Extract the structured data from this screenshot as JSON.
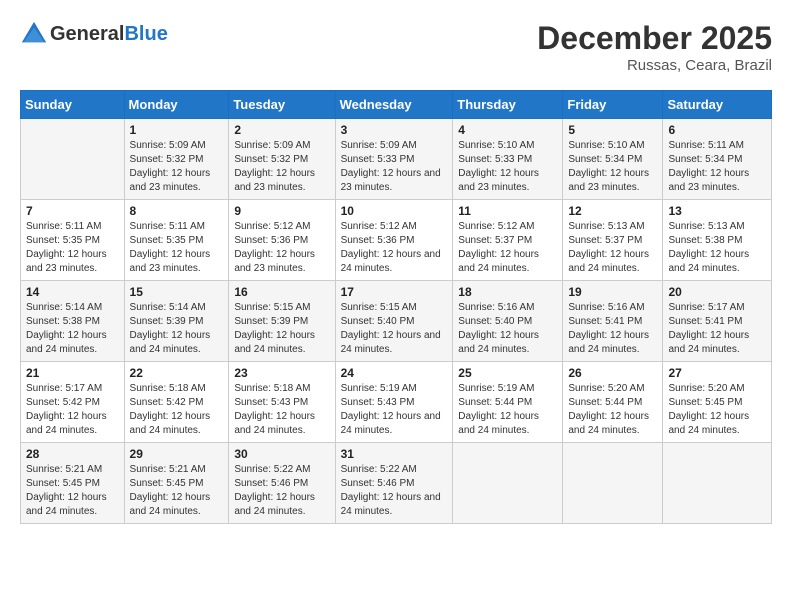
{
  "header": {
    "logo_line1": "General",
    "logo_line2": "Blue",
    "month_title": "December 2025",
    "location": "Russas, Ceara, Brazil"
  },
  "days_of_week": [
    "Sunday",
    "Monday",
    "Tuesday",
    "Wednesday",
    "Thursday",
    "Friday",
    "Saturday"
  ],
  "weeks": [
    [
      {
        "num": "",
        "sunrise": "",
        "sunset": "",
        "daylight": ""
      },
      {
        "num": "1",
        "sunrise": "Sunrise: 5:09 AM",
        "sunset": "Sunset: 5:32 PM",
        "daylight": "Daylight: 12 hours and 23 minutes."
      },
      {
        "num": "2",
        "sunrise": "Sunrise: 5:09 AM",
        "sunset": "Sunset: 5:32 PM",
        "daylight": "Daylight: 12 hours and 23 minutes."
      },
      {
        "num": "3",
        "sunrise": "Sunrise: 5:09 AM",
        "sunset": "Sunset: 5:33 PM",
        "daylight": "Daylight: 12 hours and 23 minutes."
      },
      {
        "num": "4",
        "sunrise": "Sunrise: 5:10 AM",
        "sunset": "Sunset: 5:33 PM",
        "daylight": "Daylight: 12 hours and 23 minutes."
      },
      {
        "num": "5",
        "sunrise": "Sunrise: 5:10 AM",
        "sunset": "Sunset: 5:34 PM",
        "daylight": "Daylight: 12 hours and 23 minutes."
      },
      {
        "num": "6",
        "sunrise": "Sunrise: 5:11 AM",
        "sunset": "Sunset: 5:34 PM",
        "daylight": "Daylight: 12 hours and 23 minutes."
      }
    ],
    [
      {
        "num": "7",
        "sunrise": "Sunrise: 5:11 AM",
        "sunset": "Sunset: 5:35 PM",
        "daylight": "Daylight: 12 hours and 23 minutes."
      },
      {
        "num": "8",
        "sunrise": "Sunrise: 5:11 AM",
        "sunset": "Sunset: 5:35 PM",
        "daylight": "Daylight: 12 hours and 23 minutes."
      },
      {
        "num": "9",
        "sunrise": "Sunrise: 5:12 AM",
        "sunset": "Sunset: 5:36 PM",
        "daylight": "Daylight: 12 hours and 23 minutes."
      },
      {
        "num": "10",
        "sunrise": "Sunrise: 5:12 AM",
        "sunset": "Sunset: 5:36 PM",
        "daylight": "Daylight: 12 hours and 24 minutes."
      },
      {
        "num": "11",
        "sunrise": "Sunrise: 5:12 AM",
        "sunset": "Sunset: 5:37 PM",
        "daylight": "Daylight: 12 hours and 24 minutes."
      },
      {
        "num": "12",
        "sunrise": "Sunrise: 5:13 AM",
        "sunset": "Sunset: 5:37 PM",
        "daylight": "Daylight: 12 hours and 24 minutes."
      },
      {
        "num": "13",
        "sunrise": "Sunrise: 5:13 AM",
        "sunset": "Sunset: 5:38 PM",
        "daylight": "Daylight: 12 hours and 24 minutes."
      }
    ],
    [
      {
        "num": "14",
        "sunrise": "Sunrise: 5:14 AM",
        "sunset": "Sunset: 5:38 PM",
        "daylight": "Daylight: 12 hours and 24 minutes."
      },
      {
        "num": "15",
        "sunrise": "Sunrise: 5:14 AM",
        "sunset": "Sunset: 5:39 PM",
        "daylight": "Daylight: 12 hours and 24 minutes."
      },
      {
        "num": "16",
        "sunrise": "Sunrise: 5:15 AM",
        "sunset": "Sunset: 5:39 PM",
        "daylight": "Daylight: 12 hours and 24 minutes."
      },
      {
        "num": "17",
        "sunrise": "Sunrise: 5:15 AM",
        "sunset": "Sunset: 5:40 PM",
        "daylight": "Daylight: 12 hours and 24 minutes."
      },
      {
        "num": "18",
        "sunrise": "Sunrise: 5:16 AM",
        "sunset": "Sunset: 5:40 PM",
        "daylight": "Daylight: 12 hours and 24 minutes."
      },
      {
        "num": "19",
        "sunrise": "Sunrise: 5:16 AM",
        "sunset": "Sunset: 5:41 PM",
        "daylight": "Daylight: 12 hours and 24 minutes."
      },
      {
        "num": "20",
        "sunrise": "Sunrise: 5:17 AM",
        "sunset": "Sunset: 5:41 PM",
        "daylight": "Daylight: 12 hours and 24 minutes."
      }
    ],
    [
      {
        "num": "21",
        "sunrise": "Sunrise: 5:17 AM",
        "sunset": "Sunset: 5:42 PM",
        "daylight": "Daylight: 12 hours and 24 minutes."
      },
      {
        "num": "22",
        "sunrise": "Sunrise: 5:18 AM",
        "sunset": "Sunset: 5:42 PM",
        "daylight": "Daylight: 12 hours and 24 minutes."
      },
      {
        "num": "23",
        "sunrise": "Sunrise: 5:18 AM",
        "sunset": "Sunset: 5:43 PM",
        "daylight": "Daylight: 12 hours and 24 minutes."
      },
      {
        "num": "24",
        "sunrise": "Sunrise: 5:19 AM",
        "sunset": "Sunset: 5:43 PM",
        "daylight": "Daylight: 12 hours and 24 minutes."
      },
      {
        "num": "25",
        "sunrise": "Sunrise: 5:19 AM",
        "sunset": "Sunset: 5:44 PM",
        "daylight": "Daylight: 12 hours and 24 minutes."
      },
      {
        "num": "26",
        "sunrise": "Sunrise: 5:20 AM",
        "sunset": "Sunset: 5:44 PM",
        "daylight": "Daylight: 12 hours and 24 minutes."
      },
      {
        "num": "27",
        "sunrise": "Sunrise: 5:20 AM",
        "sunset": "Sunset: 5:45 PM",
        "daylight": "Daylight: 12 hours and 24 minutes."
      }
    ],
    [
      {
        "num": "28",
        "sunrise": "Sunrise: 5:21 AM",
        "sunset": "Sunset: 5:45 PM",
        "daylight": "Daylight: 12 hours and 24 minutes."
      },
      {
        "num": "29",
        "sunrise": "Sunrise: 5:21 AM",
        "sunset": "Sunset: 5:45 PM",
        "daylight": "Daylight: 12 hours and 24 minutes."
      },
      {
        "num": "30",
        "sunrise": "Sunrise: 5:22 AM",
        "sunset": "Sunset: 5:46 PM",
        "daylight": "Daylight: 12 hours and 24 minutes."
      },
      {
        "num": "31",
        "sunrise": "Sunrise: 5:22 AM",
        "sunset": "Sunset: 5:46 PM",
        "daylight": "Daylight: 12 hours and 24 minutes."
      },
      {
        "num": "",
        "sunrise": "",
        "sunset": "",
        "daylight": ""
      },
      {
        "num": "",
        "sunrise": "",
        "sunset": "",
        "daylight": ""
      },
      {
        "num": "",
        "sunrise": "",
        "sunset": "",
        "daylight": ""
      }
    ]
  ]
}
